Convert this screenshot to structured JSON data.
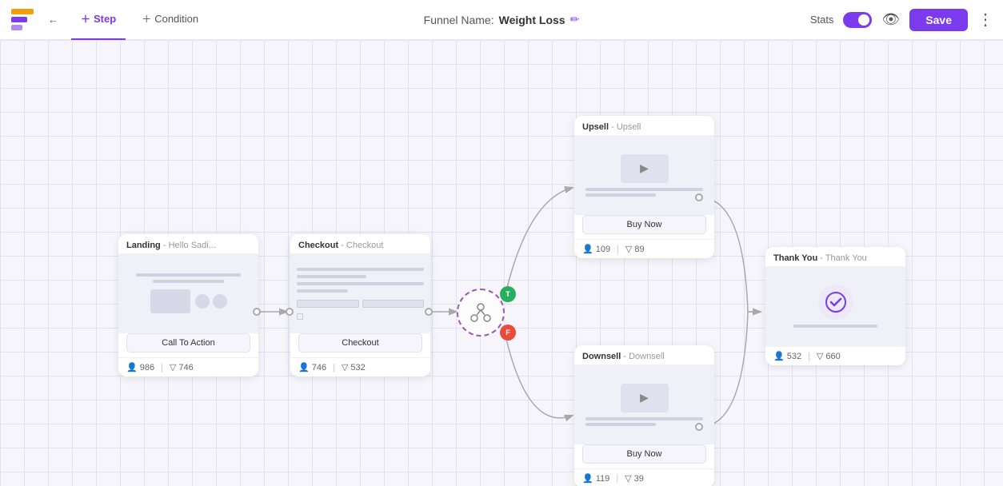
{
  "topbar": {
    "logo_alt": "Logo",
    "back_label": "←",
    "step_tab": "Step",
    "condition_tab": "Condition",
    "funnel_label": "Funnel Name:",
    "funnel_value": "Weight Loss",
    "stats_label": "Stats",
    "save_label": "Save",
    "more_icon": "⋮",
    "eye_icon": "👁"
  },
  "nodes": {
    "landing": {
      "step_name": "Landing",
      "page_name": "Hello Sadi...",
      "button": "Call To Action",
      "stat_users": "986",
      "stat_conv": "746"
    },
    "checkout": {
      "step_name": "Checkout",
      "page_name": "Checkout",
      "button": "Checkout",
      "stat_users": "746",
      "stat_conv": "532"
    },
    "upsell": {
      "step_name": "Upsell",
      "page_name": "Upsell",
      "button": "Buy Now",
      "stat_users": "109",
      "stat_conv": "89"
    },
    "downsell": {
      "step_name": "Downsell",
      "page_name": "Downsell",
      "button": "Buy Now",
      "stat_users": "119",
      "stat_conv": "39"
    },
    "thankyou": {
      "step_name": "Thank You",
      "page_name": "Thank You",
      "stat_users": "532",
      "stat_conv": "660"
    }
  },
  "condition": {
    "badge_true": "T",
    "badge_false": "F"
  }
}
